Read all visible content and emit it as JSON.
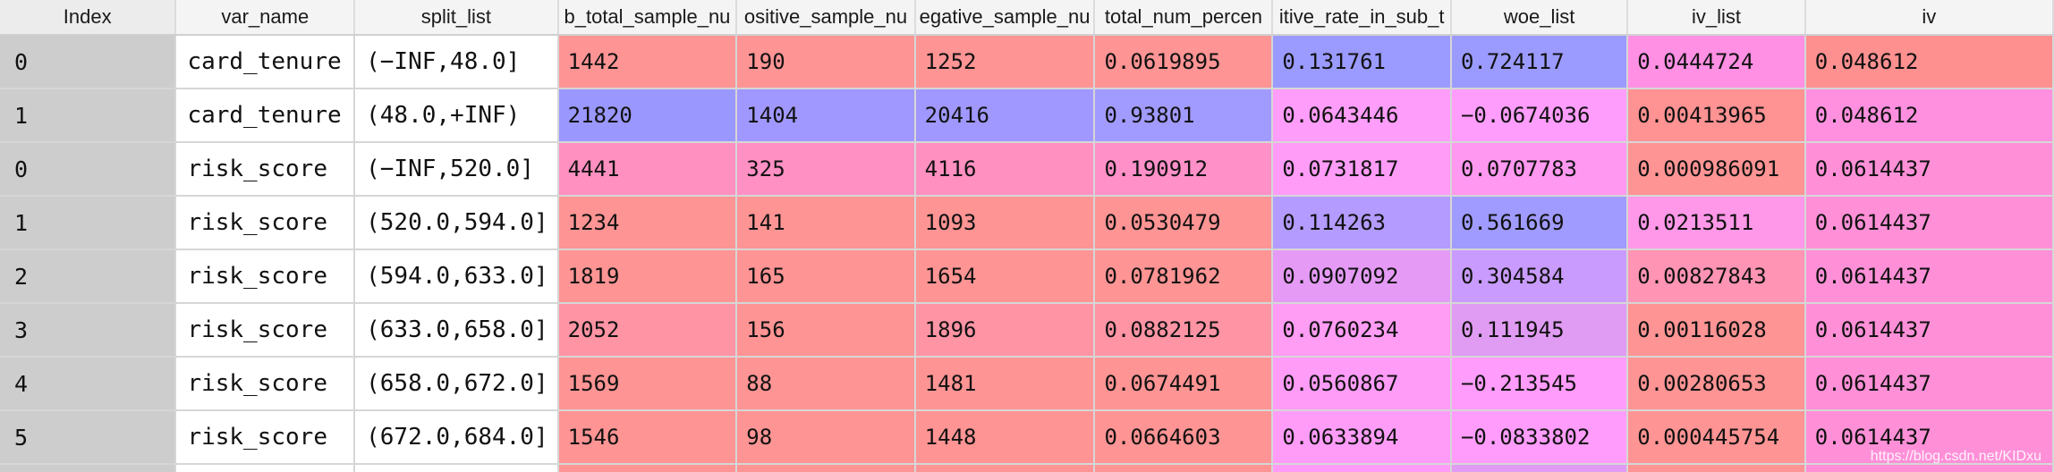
{
  "columns": [
    "Index",
    "var_name",
    "split_list",
    "b_total_sample_nu",
    "ositive_sample_nu",
    "egative_sample_nu",
    "total_num_percen",
    "itive_rate_in_sub_t",
    "woe_list",
    "iv_list",
    "iv"
  ],
  "rows": [
    {
      "cells": [
        "0",
        "card_tenure",
        "(−INF,48.0]",
        "1442",
        "190",
        "1252",
        "0.0619895",
        "0.131761",
        "0.724117",
        "0.0444724",
        "0.048612"
      ],
      "colors": [
        "#ff9494",
        "#ff9494",
        "#ff9494",
        "#ff9494",
        "#9b9bff",
        "#9b9bff",
        "#ff90e4",
        "#ff9090"
      ]
    },
    {
      "cells": [
        "1",
        "card_tenure",
        "(48.0,+INF)",
        "21820",
        "1404",
        "20416",
        "0.93801",
        "0.0643446",
        "−0.0674036",
        "0.00413965",
        "0.048612"
      ],
      "colors": [
        "#9a98ff",
        "#a098ff",
        "#a098ff",
        "#a29bff",
        "#ff9dfb",
        "#ff9dfd",
        "#ff9292",
        "#ff90e0"
      ]
    },
    {
      "cells": [
        "0",
        "risk_score",
        "(−INF,520.0]",
        "4441",
        "325",
        "4116",
        "0.190912",
        "0.0731817",
        "0.0707783",
        "0.000986091",
        "0.0614437"
      ],
      "colors": [
        "#ff90c0",
        "#ff90c4",
        "#ff90c0",
        "#ff90c8",
        "#ff9cf8",
        "#ff98f0",
        "#ff9494",
        "#ff90d8"
      ]
    },
    {
      "cells": [
        "1",
        "risk_score",
        "(520.0,594.0]",
        "1234",
        "141",
        "1093",
        "0.0530479",
        "0.114263",
        "0.561669",
        "0.0213511",
        "0.0614437"
      ],
      "colors": [
        "#ff9494",
        "#ff9494",
        "#ff9494",
        "#ff9494",
        "#b39bff",
        "#a09bff",
        "#ff98e8",
        "#ff90d8"
      ]
    },
    {
      "cells": [
        "2",
        "risk_score",
        "(594.0,633.0]",
        "1819",
        "165",
        "1654",
        "0.0781962",
        "0.0907092",
        "0.304584",
        "0.00827843",
        "0.0614437"
      ],
      "colors": [
        "#ff9494",
        "#ff9494",
        "#ff9494",
        "#ff9494",
        "#e59bf5",
        "#c99bff",
        "#ff94b4",
        "#ff90d8"
      ]
    },
    {
      "cells": [
        "3",
        "risk_score",
        "(633.0,658.0]",
        "2052",
        "156",
        "1896",
        "0.0882125",
        "0.0760234",
        "0.111945",
        "0.00116028",
        "0.0614437"
      ],
      "colors": [
        "#ff94a4",
        "#ff9494",
        "#ff94a4",
        "#ff94a4",
        "#ff9cf4",
        "#e09bf2",
        "#ff9494",
        "#ff90d8"
      ]
    },
    {
      "cells": [
        "4",
        "risk_score",
        "(658.0,672.0]",
        "1569",
        "88",
        "1481",
        "0.0674491",
        "0.0560867",
        "−0.213545",
        "0.00280653",
        "0.0614437"
      ],
      "colors": [
        "#ff9494",
        "#ff9494",
        "#ff9494",
        "#ff9494",
        "#ff9cf8",
        "#ff9cfc",
        "#ff9494",
        "#ff90d8"
      ]
    },
    {
      "cells": [
        "5",
        "risk_score",
        "(672.0,684.0]",
        "1546",
        "98",
        "1448",
        "0.0664603",
        "0.0633894",
        "−0.0833802",
        "0.000445754",
        "0.0614437"
      ],
      "colors": [
        "#ff9494",
        "#ff9494",
        "#ff9494",
        "#ff9494",
        "#ff9cf8",
        "#ff9cfc",
        "#ff9494",
        "#ff90d8"
      ]
    }
  ],
  "partial_row_colors": [
    "#cdcdcd",
    "#ffffff",
    "#ffffff",
    "#ff9494",
    "#ff9494",
    "#ff9494",
    "#ff9494",
    "#ff9cf8",
    "#e09bf2",
    "#ff9494",
    "#ff90d8"
  ],
  "watermark": "https://blog.csdn.net/KIDxu"
}
